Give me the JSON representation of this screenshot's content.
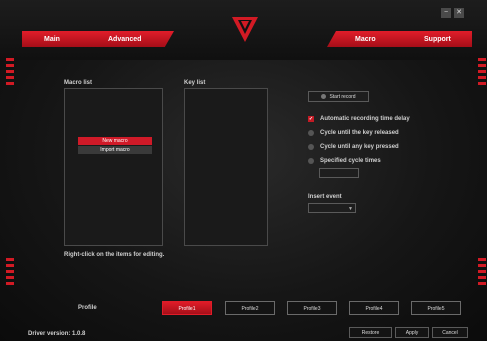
{
  "window": {
    "minimize_glyph": "−",
    "close_glyph": "✕"
  },
  "tabs": {
    "main": "Main",
    "advanced": "Advanced",
    "macro": "Macro",
    "support": "Support"
  },
  "colors": {
    "accent": "#d21a24",
    "background": "#161616",
    "panel": "#1a1a1a"
  },
  "macro_list": {
    "label": "Macro list",
    "context_menu": [
      "New macro",
      "Import macro"
    ]
  },
  "key_list": {
    "label": "Key list"
  },
  "record": {
    "button": "Start record"
  },
  "options": {
    "auto_delay": "Automatic recording time delay",
    "cycle_release": "Cycle until the key released",
    "cycle_press": "Cycle until any key pressed",
    "cycle_times": "Specified cycle times",
    "cycle_times_value": ""
  },
  "insert_event": {
    "label": "Insert event",
    "selected": ""
  },
  "hint": "Right-click on the items for editing.",
  "profile": {
    "label": "Profile",
    "items": [
      "Profile1",
      "Profile2",
      "Profile3",
      "Profile4",
      "Profile5"
    ],
    "active": "Profile1"
  },
  "footer": {
    "driver_version": "Driver version:  1.0.8",
    "restore": "Restore",
    "apply": "Apply",
    "cancel": "Cancel"
  },
  "icons": {
    "logo": "v-logo-icon",
    "record": "record-icon",
    "dropdown": "chevron-down-icon"
  }
}
